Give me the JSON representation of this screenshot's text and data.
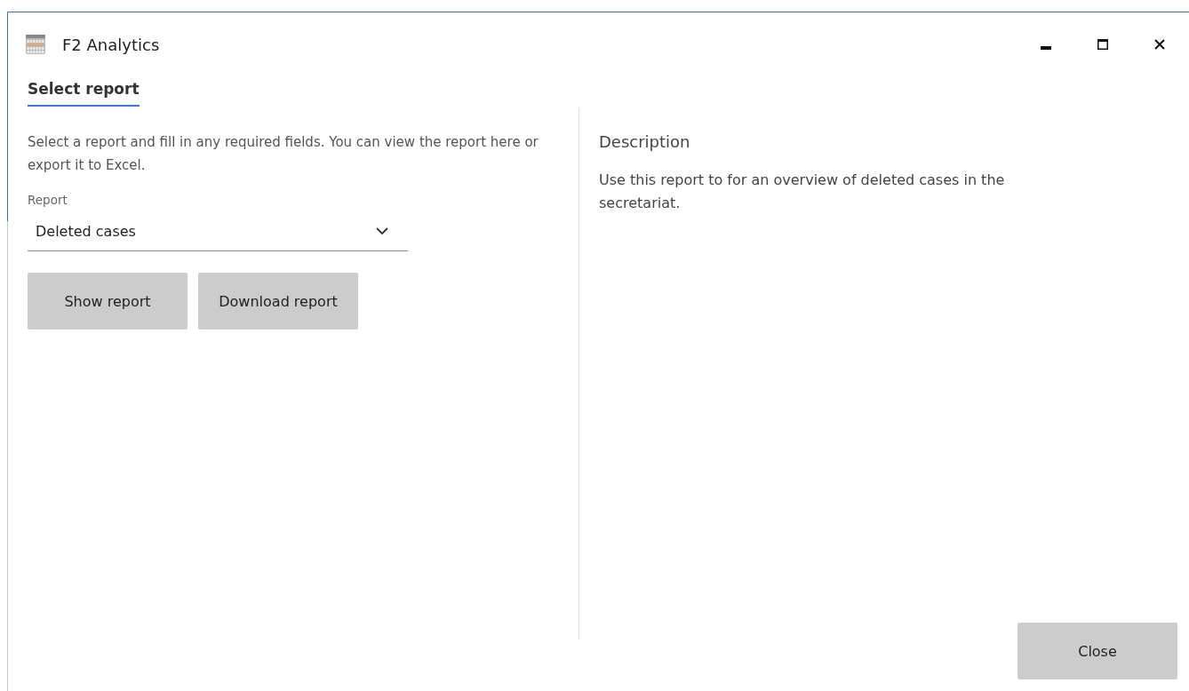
{
  "window": {
    "title": "F2 Analytics"
  },
  "tabs": [
    {
      "label": "Select report",
      "selected": true
    }
  ],
  "intro": "Select a report and fill in any required fields. You can view the report here or export it to Excel.",
  "report_field": {
    "label": "Report",
    "value": "Deleted cases"
  },
  "buttons": [
    "Show report",
    "Download report"
  ],
  "description": {
    "heading": "Description",
    "text": "Use this report to for an overview of deleted cases in the secretariat."
  },
  "footer_button": "Close"
}
